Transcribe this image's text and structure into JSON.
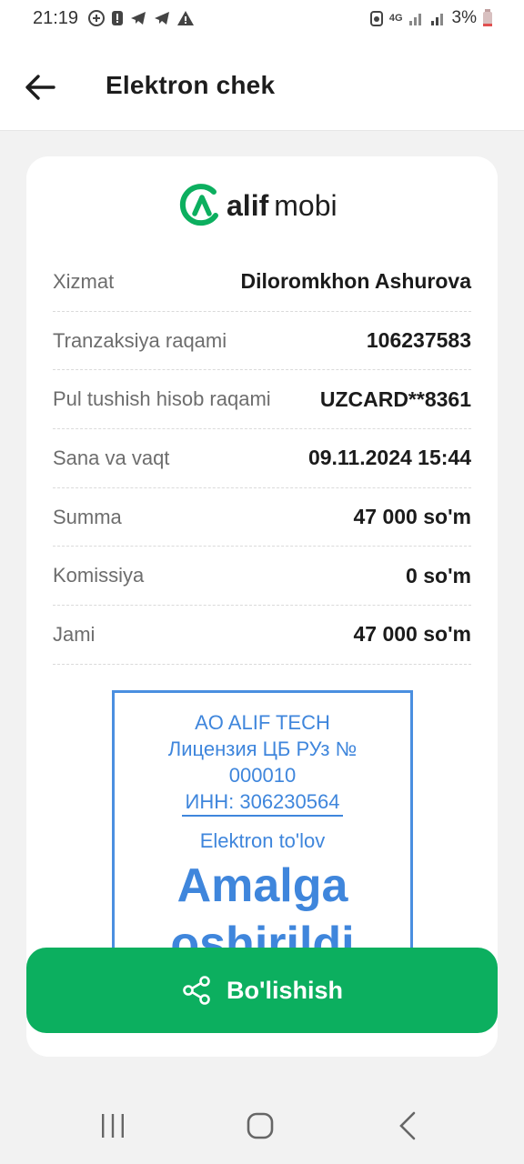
{
  "status_bar": {
    "time": "21:19",
    "battery_percent": "3%",
    "network": "4G",
    "icons_left": [
      "messenger-icon",
      "alert-icon",
      "telegram-icon",
      "telegram-icon",
      "warning-icon"
    ],
    "icons_right": [
      "battery-saver-icon",
      "network-4g-icon",
      "signal-icon",
      "signal-icon",
      "battery-icon"
    ]
  },
  "header": {
    "title": "Elektron chek",
    "back_icon": "arrow-left-icon"
  },
  "logo": {
    "brand": "alif",
    "sub": "mobi",
    "accent_color": "#0caf5f"
  },
  "details": [
    {
      "label": "Xizmat",
      "value": "Diloromkhon Ashurova"
    },
    {
      "label": "Tranzaksiya raqami",
      "value": "106237583"
    },
    {
      "label": "Pul tushish hisob raqami",
      "value": "UZCARD**8361"
    },
    {
      "label": "Sana va vaqt",
      "value": "09.11.2024 15:44"
    },
    {
      "label": "Summa",
      "value": "47 000 so'm"
    },
    {
      "label": "Komissiya",
      "value": "0 so'm"
    },
    {
      "label": "Jami",
      "value": "47 000 so'm"
    }
  ],
  "stamp": {
    "company": "AO ALIF TECH",
    "license_line1": "Лицензия ЦБ РУз №",
    "license_line2": "000010",
    "inn": "ИНН: 306230564",
    "type": "Elektron to'lov",
    "status_line1": "Amalga",
    "status_line2": "oshirildi",
    "color": "#3f86dc"
  },
  "share_button": {
    "label": "Bo'lishish",
    "icon": "share-icon",
    "color": "#0caf5f"
  },
  "nav": {
    "recent_icon": "recent-apps-icon",
    "home_icon": "home-icon",
    "back_icon": "back-chevron-icon"
  }
}
